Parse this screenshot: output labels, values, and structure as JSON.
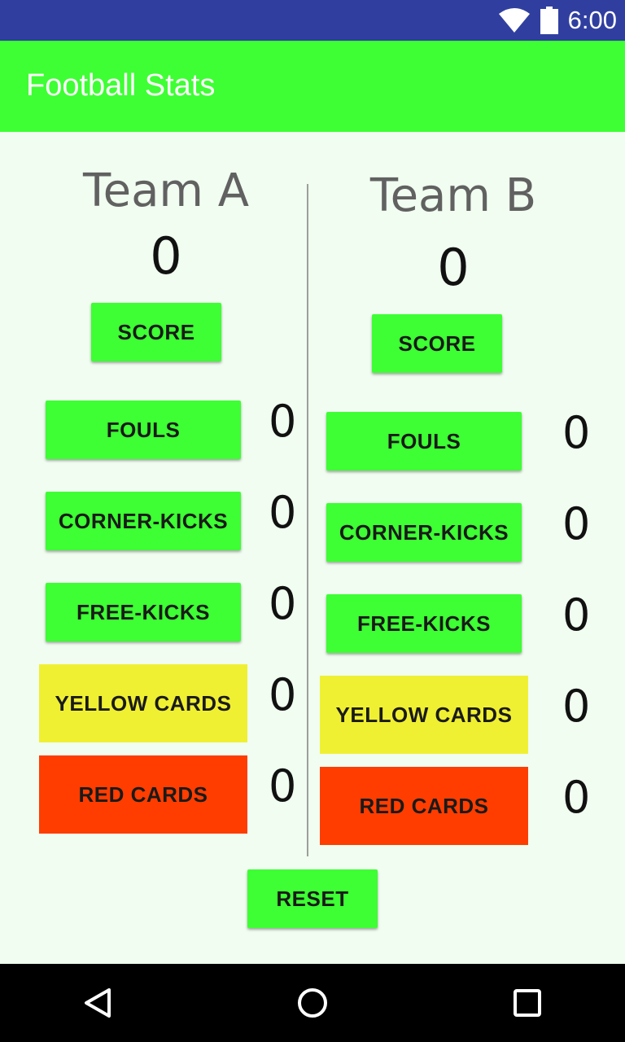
{
  "status_bar": {
    "time": "6:00",
    "icons": [
      "wifi-icon",
      "battery-icon"
    ]
  },
  "app_bar": {
    "title": "Football Stats",
    "color": "#3dff33"
  },
  "team_a": {
    "name": "Team A",
    "score": "0",
    "score_label": "SCORE",
    "stats": [
      {
        "label": "FOULS",
        "value": "0"
      },
      {
        "label": "CORNER-KICKS",
        "value": "0"
      },
      {
        "label": "FREE-KICKS",
        "value": "0"
      },
      {
        "label": "YELLOW CARDS",
        "value": "0"
      },
      {
        "label": "RED CARDS",
        "value": "0"
      }
    ]
  },
  "team_b": {
    "name": "Team B",
    "score": "0",
    "score_label": "SCORE",
    "stats": [
      {
        "label": "FOULS",
        "value": "0"
      },
      {
        "label": "CORNER-KICKS",
        "value": "0"
      },
      {
        "label": "FREE-KICKS",
        "value": "0"
      },
      {
        "label": "YELLOW CARDS",
        "value": "0"
      },
      {
        "label": "RED CARDS",
        "value": "0"
      }
    ]
  },
  "reset_label": "RESET",
  "colors": {
    "green": "#3dff33",
    "yellow": "#f0f032",
    "red": "#ff3d00",
    "status_bar": "#303f9f"
  },
  "nav_bar": {
    "icons": [
      "back-icon",
      "home-icon",
      "recents-icon"
    ]
  }
}
